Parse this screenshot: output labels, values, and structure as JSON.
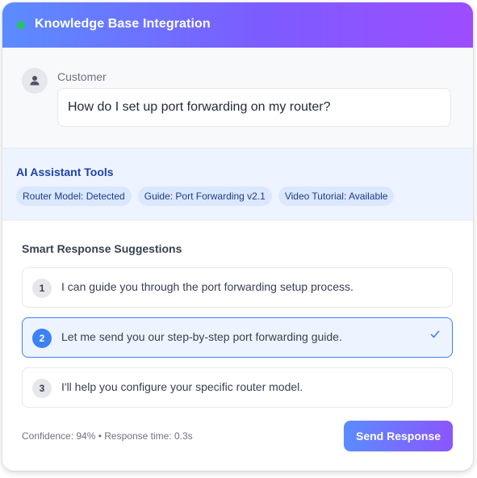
{
  "header": {
    "title": "Knowledge Base Integration",
    "status_color": "#22c55e"
  },
  "customer": {
    "label": "Customer",
    "avatar_icon": "user-icon",
    "message": "How do I set up port forwarding on my router?"
  },
  "tools": {
    "title": "AI Assistant Tools",
    "chips": [
      "Router Model: Detected",
      "Guide: Port Forwarding v2.1",
      "Video Tutorial: Available"
    ]
  },
  "suggestions": {
    "title": "Smart Response Suggestions",
    "items": [
      {
        "number": "1",
        "text": "I can guide you through the port forwarding setup process.",
        "selected": false
      },
      {
        "number": "2",
        "text": "Let me send you our step-by-step port forwarding guide.",
        "selected": true
      },
      {
        "number": "3",
        "text": "I'll help you configure your specific router model.",
        "selected": false
      }
    ],
    "selected_icon": "check-icon"
  },
  "footer": {
    "meta": "Confidence: 94% • Response time: 0.3s",
    "send_label": "Send Response"
  },
  "colors": {
    "accent": "#3b82f6",
    "gradient_start": "#5b8cff",
    "gradient_end": "#9d4dff"
  }
}
